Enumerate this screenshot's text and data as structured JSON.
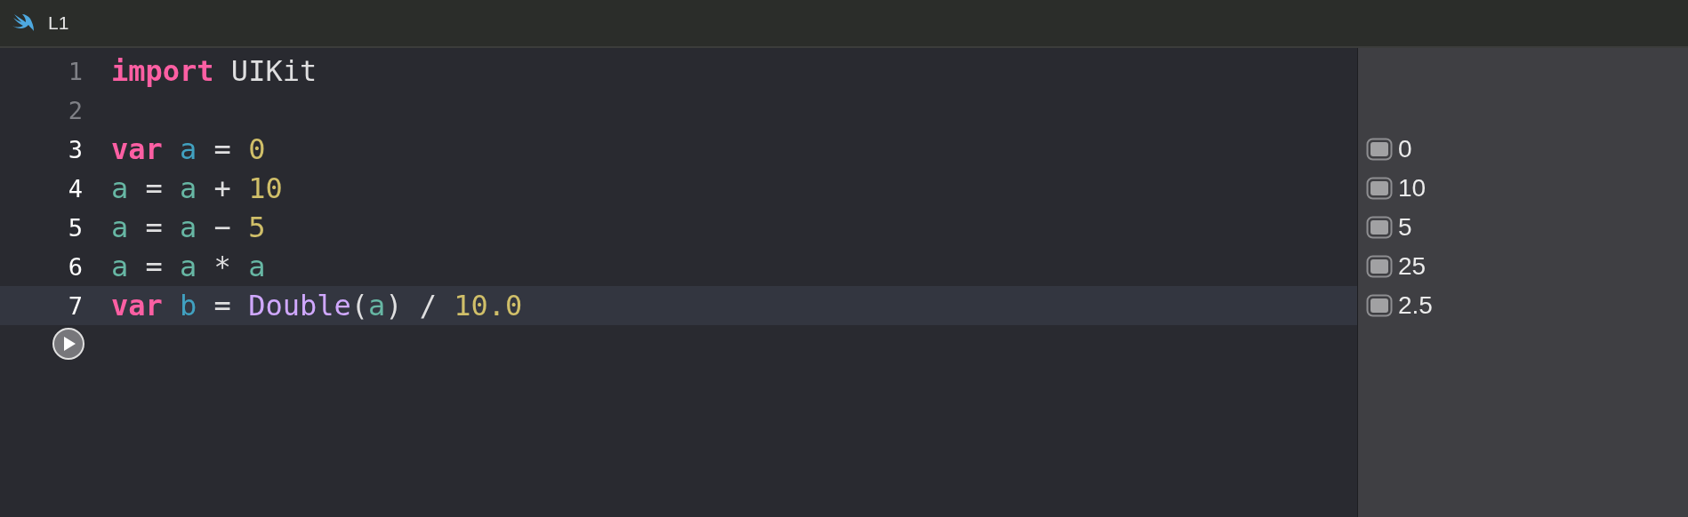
{
  "window": {
    "title": "L1"
  },
  "lines": [
    {
      "number": "1",
      "executed": false,
      "current": false,
      "tokens": [
        {
          "text": "import",
          "kind": "keyword"
        },
        {
          "text": " UIKit",
          "kind": "plain"
        }
      ]
    },
    {
      "number": "2",
      "executed": false,
      "current": false
    },
    {
      "number": "3",
      "executed": true,
      "current": false,
      "result": "0",
      "tokens": [
        {
          "text": "var ",
          "kind": "keyword"
        },
        {
          "text": "a",
          "kind": "declaration"
        },
        {
          "text": " = ",
          "kind": "plain"
        },
        {
          "text": "0",
          "kind": "number"
        }
      ]
    },
    {
      "number": "4",
      "executed": true,
      "current": false,
      "result": "10",
      "tokens": [
        {
          "text": "a",
          "kind": "reference"
        },
        {
          "text": " = ",
          "kind": "plain"
        },
        {
          "text": "a",
          "kind": "reference"
        },
        {
          "text": " + ",
          "kind": "plain"
        },
        {
          "text": "10",
          "kind": "number"
        }
      ]
    },
    {
      "number": "5",
      "executed": true,
      "current": false,
      "result": "5",
      "tokens": [
        {
          "text": "a",
          "kind": "reference"
        },
        {
          "text": " = ",
          "kind": "plain"
        },
        {
          "text": "a",
          "kind": "reference"
        },
        {
          "text": " − ",
          "kind": "plain"
        },
        {
          "text": "5",
          "kind": "number"
        }
      ]
    },
    {
      "number": "6",
      "executed": true,
      "current": false,
      "result": "25",
      "tokens": [
        {
          "text": "a",
          "kind": "reference"
        },
        {
          "text": " = ",
          "kind": "plain"
        },
        {
          "text": "a",
          "kind": "reference"
        },
        {
          "text": " * ",
          "kind": "plain"
        },
        {
          "text": "a",
          "kind": "reference"
        }
      ]
    },
    {
      "number": "7",
      "executed": true,
      "current": true,
      "result": "2.5",
      "tokens": [
        {
          "text": "var ",
          "kind": "keyword"
        },
        {
          "text": "b",
          "kind": "declaration"
        },
        {
          "text": " = ",
          "kind": "plain"
        },
        {
          "text": "Double",
          "kind": "type"
        },
        {
          "text": "(",
          "kind": "plain"
        },
        {
          "text": "a",
          "kind": "reference"
        },
        {
          "text": ") / ",
          "kind": "plain"
        },
        {
          "text": "10.0",
          "kind": "number"
        }
      ]
    }
  ]
}
